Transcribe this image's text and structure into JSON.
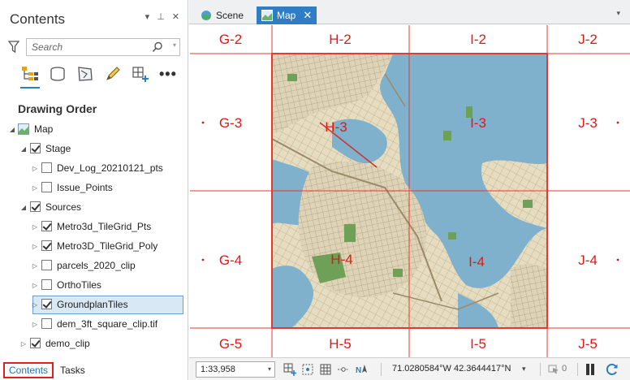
{
  "contents": {
    "title": "Contents",
    "controls": {
      "menu": "▾",
      "pin": "⊥",
      "close": "✕"
    },
    "search": {
      "placeholder": "Search"
    },
    "toolbar_more": "•••",
    "section_title": "Drawing Order",
    "tree": [
      {
        "label": "Map",
        "level": 0,
        "checkbox": false,
        "icon": "map-icon",
        "expanded": true
      },
      {
        "label": "Stage",
        "level": 1,
        "checkbox": true,
        "checked": true,
        "expanded": true
      },
      {
        "label": "Dev_Log_20210121_pts",
        "level": 2,
        "checkbox": true,
        "checked": false,
        "expanded": false
      },
      {
        "label": "Issue_Points",
        "level": 2,
        "checkbox": true,
        "checked": false,
        "expanded": false
      },
      {
        "label": "Sources",
        "level": 1,
        "checkbox": true,
        "checked": true,
        "expanded": true
      },
      {
        "label": "Metro3d_TileGrid_Pts",
        "level": 2,
        "checkbox": true,
        "checked": true,
        "expanded": false
      },
      {
        "label": "Metro3D_TileGrid_Poly",
        "level": 2,
        "checkbox": true,
        "checked": true,
        "expanded": false
      },
      {
        "label": "parcels_2020_clip",
        "level": 2,
        "checkbox": true,
        "checked": false,
        "expanded": false
      },
      {
        "label": "OrthoTiles",
        "level": 2,
        "checkbox": true,
        "checked": false,
        "expanded": false
      },
      {
        "label": "GroundplanTiles",
        "level": 2,
        "checkbox": true,
        "checked": true,
        "expanded": false,
        "selected": true
      },
      {
        "label": "dem_3ft_square_clip.tif",
        "level": 2,
        "checkbox": true,
        "checked": false,
        "expanded": false
      },
      {
        "label": "demo_clip",
        "level": 1,
        "checkbox": true,
        "checked": true,
        "expanded": false
      }
    ],
    "bottom_tabs": [
      {
        "label": "Contents",
        "active": true
      },
      {
        "label": "Tasks",
        "active": false
      }
    ]
  },
  "view_tabs": [
    {
      "label": "Scene",
      "active": false
    },
    {
      "label": "Map",
      "active": true
    }
  ],
  "grid": {
    "rows": [
      [
        "G-2",
        "H-2",
        "I-2",
        "J-2"
      ],
      [
        "G-3",
        "H-3",
        "I-3",
        "J-3"
      ],
      [
        "G-4",
        "H-4",
        "I-4",
        "J-4"
      ],
      [
        "G-5",
        "H-5",
        "I-5",
        "J-5"
      ]
    ],
    "line_color": "#e53935",
    "label_color": "#e01818"
  },
  "status": {
    "scale": "1:33,958",
    "coordinates": "71.0280584°W 42.3644417°N",
    "selected_count": "0"
  },
  "colors": {
    "accent": "#2f7dc7",
    "water": "#7fb1cc",
    "land": "#e8e0c8",
    "park": "#6fa058",
    "highlight_border": "#e02020"
  }
}
